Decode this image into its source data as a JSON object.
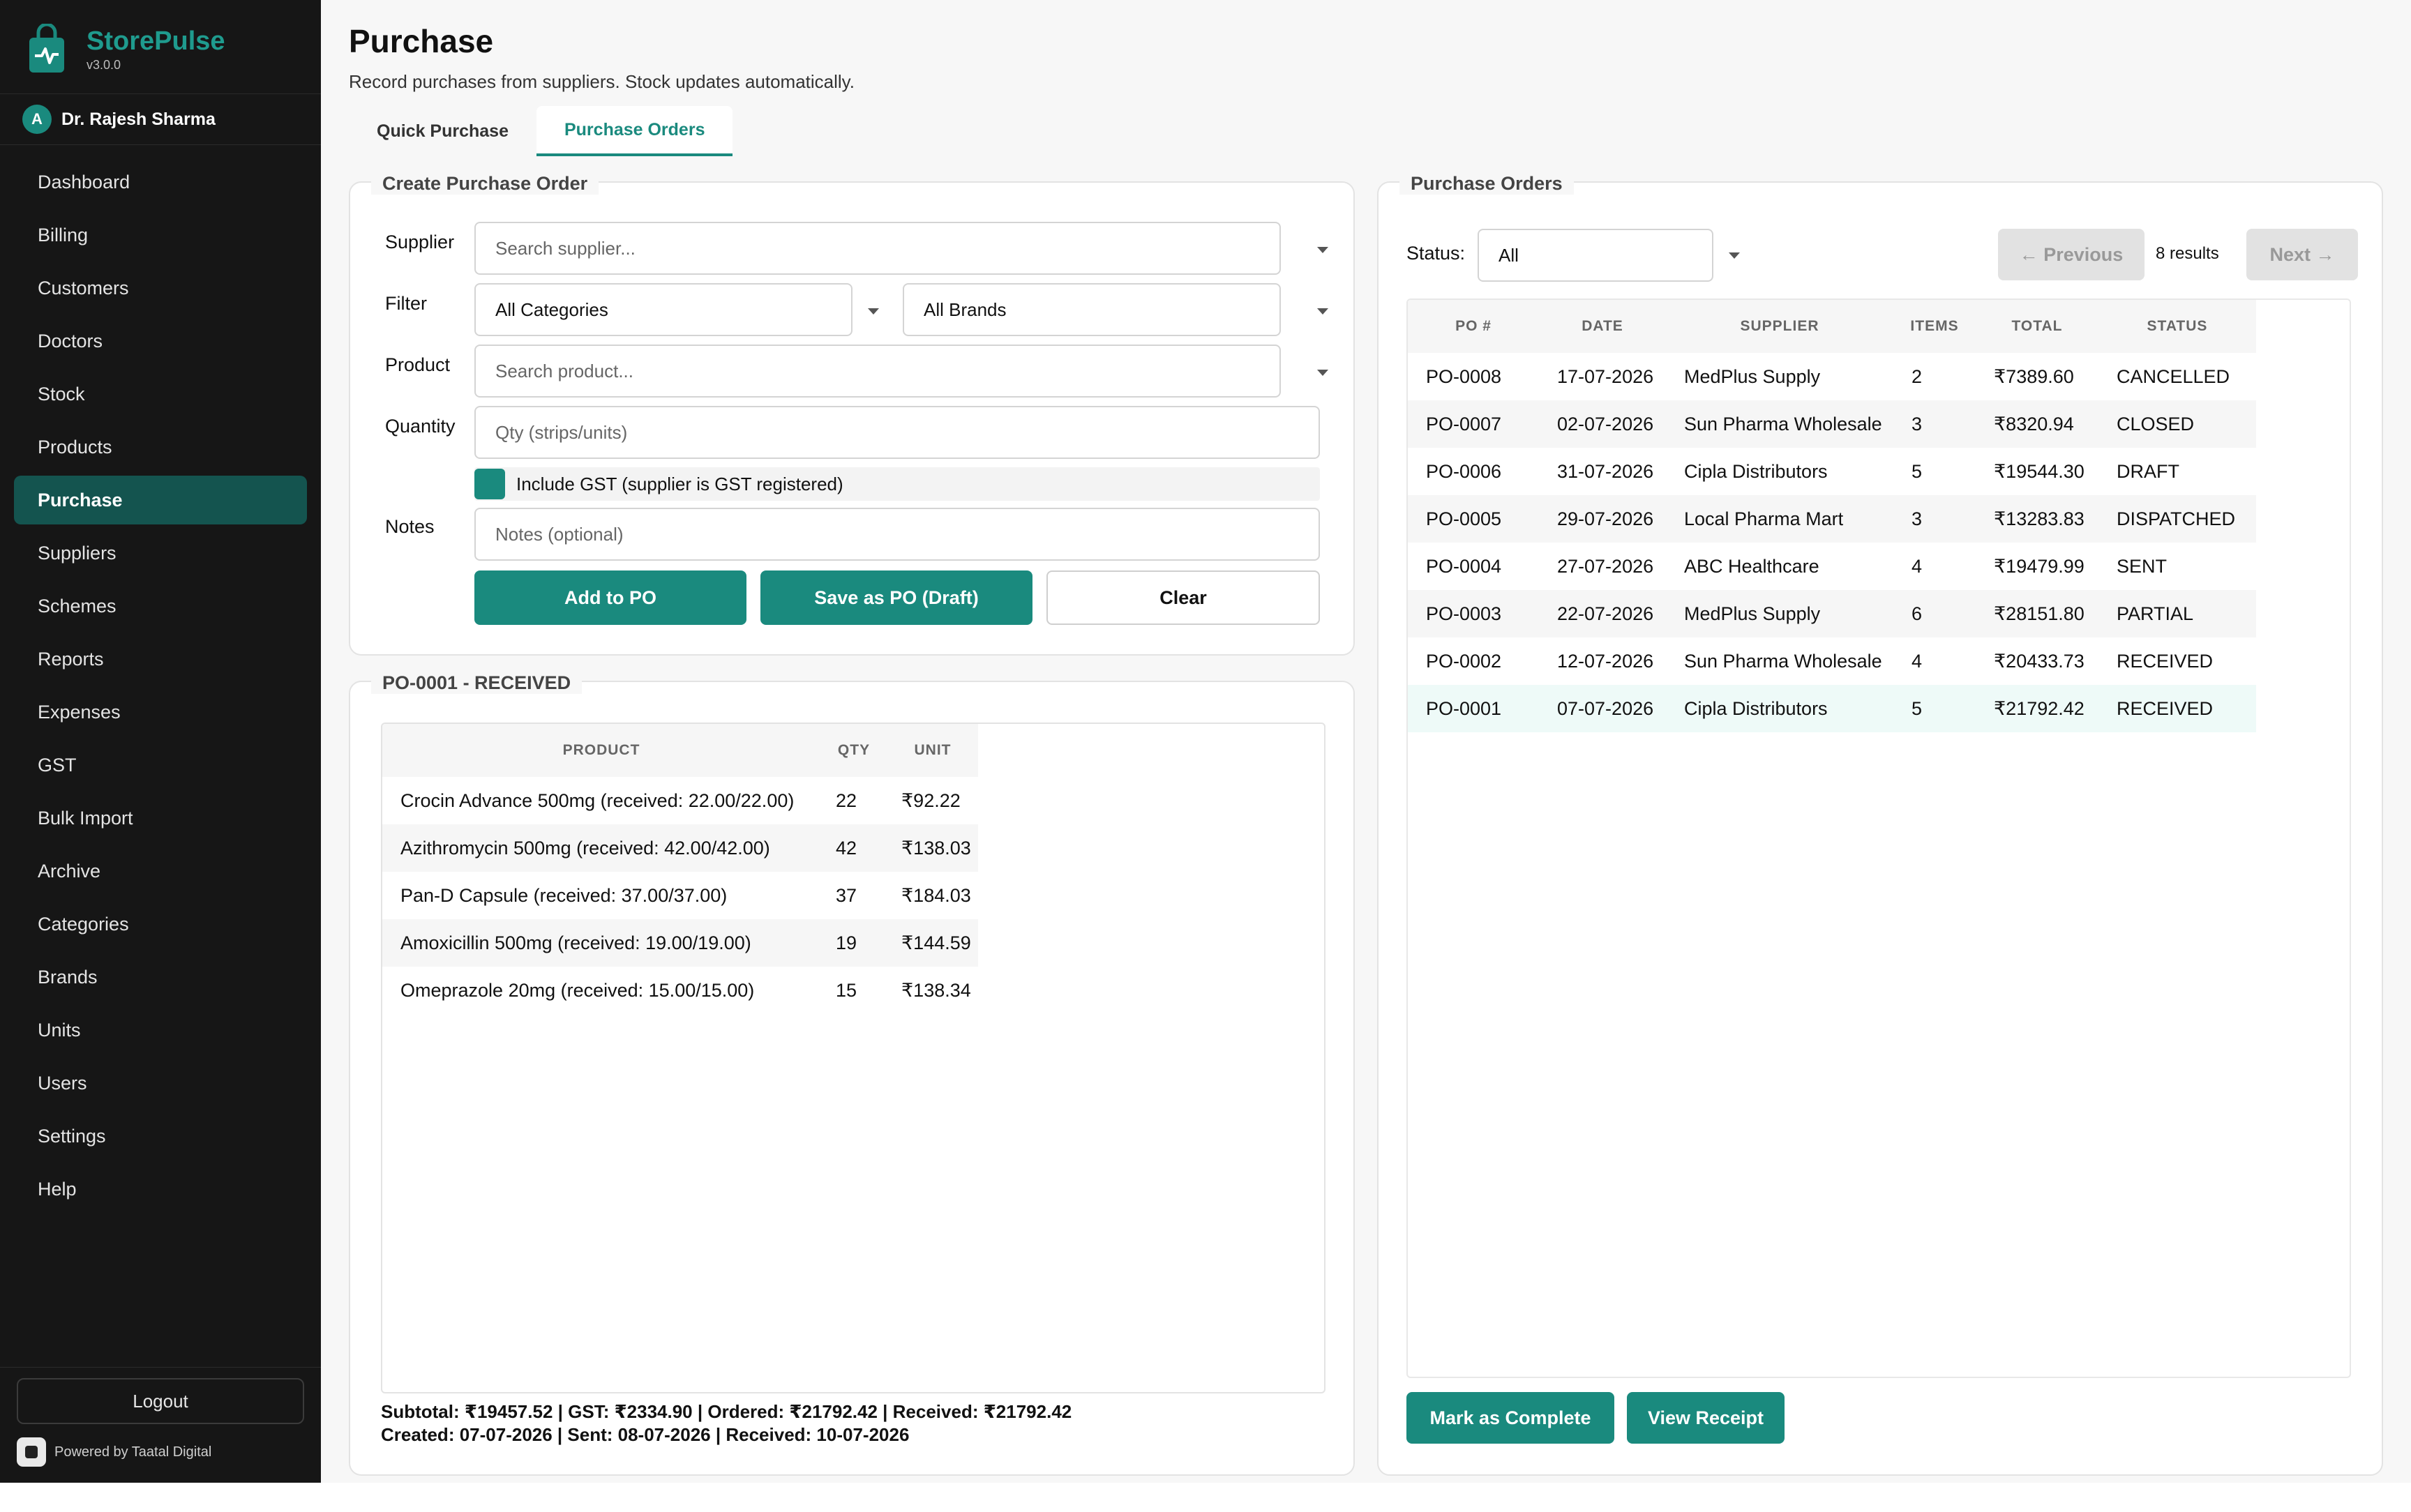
{
  "app": {
    "name": "StorePulse",
    "version": "v3.0.0"
  },
  "user": {
    "initial": "A",
    "name": "Dr. Rajesh Sharma"
  },
  "sidebar": {
    "items": [
      {
        "label": "Dashboard"
      },
      {
        "label": "Billing"
      },
      {
        "label": "Customers"
      },
      {
        "label": "Doctors"
      },
      {
        "label": "Stock"
      },
      {
        "label": "Products"
      },
      {
        "label": "Purchase"
      },
      {
        "label": "Suppliers"
      },
      {
        "label": "Schemes"
      },
      {
        "label": "Reports"
      },
      {
        "label": "Expenses"
      },
      {
        "label": "GST"
      },
      {
        "label": "Bulk Import"
      },
      {
        "label": "Archive"
      },
      {
        "label": "Categories"
      },
      {
        "label": "Brands"
      },
      {
        "label": "Units"
      },
      {
        "label": "Users"
      },
      {
        "label": "Settings"
      },
      {
        "label": "Help"
      }
    ],
    "active": "Purchase",
    "logout": "Logout",
    "powered_by": "Powered by Taatal Digital"
  },
  "page": {
    "title": "Purchase",
    "subtitle": "Record purchases from suppliers. Stock updates automatically.",
    "tabs": [
      {
        "label": "Quick Purchase"
      },
      {
        "label": "Purchase Orders"
      }
    ],
    "active_tab": "Purchase Orders"
  },
  "create_po": {
    "legend": "Create Purchase Order",
    "supplier_label": "Supplier",
    "supplier_placeholder": "Search supplier...",
    "filter_label": "Filter",
    "category_value": "All Categories",
    "brand_value": "All Brands",
    "product_label": "Product",
    "product_placeholder": "Search product...",
    "quantity_label": "Quantity",
    "quantity_placeholder": "Qty (strips/units)",
    "gst_label": "Include GST (supplier is GST registered)",
    "gst_checked": true,
    "notes_label": "Notes",
    "notes_placeholder": "Notes (optional)",
    "add_button": "Add to PO",
    "save_button": "Save as PO (Draft)",
    "clear_button": "Clear"
  },
  "po_detail": {
    "legend": "PO-0001 - RECEIVED",
    "columns": [
      "PRODUCT",
      "QTY",
      "UNIT"
    ],
    "items": [
      {
        "product": "Crocin Advance 500mg (received: 22.00/22.00)",
        "qty": "22",
        "unit": "₹92.22"
      },
      {
        "product": "Azithromycin 500mg (received: 42.00/42.00)",
        "qty": "42",
        "unit": "₹138.03"
      },
      {
        "product": "Pan-D Capsule (received: 37.00/37.00)",
        "qty": "37",
        "unit": "₹184.03"
      },
      {
        "product": "Amoxicillin 500mg (received: 19.00/19.00)",
        "qty": "19",
        "unit": "₹144.59"
      },
      {
        "product": "Omeprazole 20mg (received: 15.00/15.00)",
        "qty": "15",
        "unit": "₹138.34"
      }
    ],
    "totals_line": "Subtotal: ₹19457.52 | GST: ₹2334.90 | Ordered: ₹21792.42 | Received: ₹21792.42",
    "dates_line": "Created: 07-07-2026 | Sent: 08-07-2026 | Received: 10-07-2026"
  },
  "orders": {
    "legend": "Purchase Orders",
    "status_label": "Status:",
    "status_value": "All",
    "prev_button": "← Previous",
    "results": "8 results",
    "next_button": "Next →",
    "columns": [
      "PO #",
      "DATE",
      "SUPPLIER",
      "ITEMS",
      "TOTAL",
      "STATUS"
    ],
    "rows": [
      {
        "po": "PO-0008",
        "date": "17-07-2026",
        "supplier": "MedPlus Supply",
        "items": "2",
        "total": "₹7389.60",
        "status": "CANCELLED"
      },
      {
        "po": "PO-0007",
        "date": "02-07-2026",
        "supplier": "Sun Pharma Wholesale",
        "items": "3",
        "total": "₹8320.94",
        "status": "CLOSED"
      },
      {
        "po": "PO-0006",
        "date": "31-07-2026",
        "supplier": "Cipla Distributors",
        "items": "5",
        "total": "₹19544.30",
        "status": "DRAFT"
      },
      {
        "po": "PO-0005",
        "date": "29-07-2026",
        "supplier": "Local Pharma Mart",
        "items": "3",
        "total": "₹13283.83",
        "status": "DISPATCHED"
      },
      {
        "po": "PO-0004",
        "date": "27-07-2026",
        "supplier": "ABC Healthcare",
        "items": "4",
        "total": "₹19479.99",
        "status": "SENT"
      },
      {
        "po": "PO-0003",
        "date": "22-07-2026",
        "supplier": "MedPlus Supply",
        "items": "6",
        "total": "₹28151.80",
        "status": "PARTIAL"
      },
      {
        "po": "PO-0002",
        "date": "12-07-2026",
        "supplier": "Sun Pharma Wholesale",
        "items": "4",
        "total": "₹20433.73",
        "status": "RECEIVED"
      },
      {
        "po": "PO-0001",
        "date": "07-07-2026",
        "supplier": "Cipla Distributors",
        "items": "5",
        "total": "₹21792.42",
        "status": "RECEIVED"
      }
    ],
    "selected_po": "PO-0001",
    "complete_button": "Mark as Complete",
    "receipt_button": "View Receipt"
  },
  "colors": {
    "accent": "#1a8a7e",
    "sidebar_bg": "#161616",
    "active_nav": "#14544f"
  }
}
